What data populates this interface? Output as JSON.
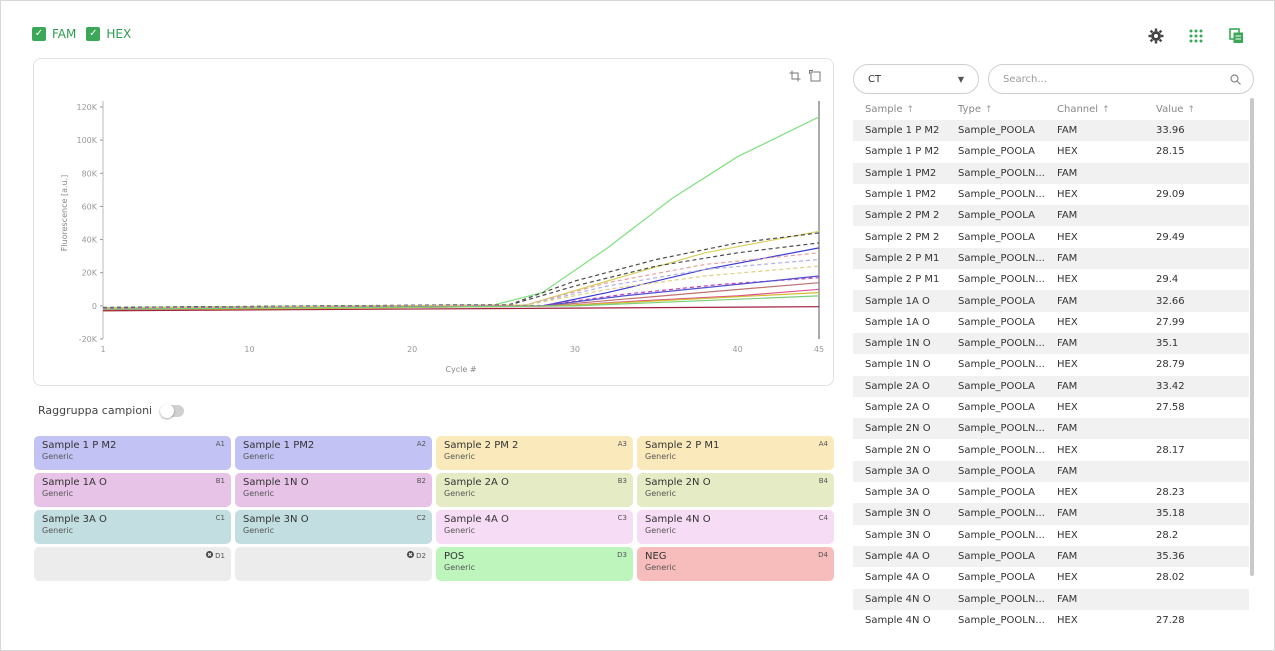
{
  "channels": [
    {
      "label": "FAM",
      "checked": true
    },
    {
      "label": "HEX",
      "checked": true
    }
  ],
  "toolbar_icons": [
    "settings-icon",
    "grid-dots-icon",
    "copy-icon"
  ],
  "chart_data": {
    "type": "line",
    "xlabel": "Cycle #",
    "ylabel": "Fluorescence [a.u.]",
    "xlim": [
      1,
      45
    ],
    "ylim": [
      -20000,
      120000
    ],
    "x_ticks": [
      "1",
      "10",
      "20",
      "30",
      "40",
      "45"
    ],
    "y_ticks": [
      "120K",
      "100K",
      "80K",
      "60K",
      "40K",
      "20K",
      "0",
      "-20K"
    ],
    "series": [
      {
        "color": "#7fe07f",
        "dash": false,
        "values": [
          [
            1,
            -1000
          ],
          [
            25,
            500
          ],
          [
            28,
            8000
          ],
          [
            32,
            35000
          ],
          [
            36,
            65000
          ],
          [
            40,
            90000
          ],
          [
            45,
            114000
          ]
        ]
      },
      {
        "color": "#d9d060",
        "dash": false,
        "values": [
          [
            1,
            -1500
          ],
          [
            27,
            500
          ],
          [
            32,
            15000
          ],
          [
            38,
            32000
          ],
          [
            45,
            45000
          ]
        ]
      },
      {
        "color": "#4a4a4a",
        "dash": true,
        "values": [
          [
            1,
            -1000
          ],
          [
            26,
            800
          ],
          [
            30,
            15000
          ],
          [
            35,
            28000
          ],
          [
            40,
            38000
          ],
          [
            45,
            44000
          ]
        ]
      },
      {
        "color": "#4a4a4a",
        "dash": true,
        "values": [
          [
            1,
            -1000
          ],
          [
            26,
            600
          ],
          [
            30,
            12000
          ],
          [
            35,
            24000
          ],
          [
            40,
            32000
          ],
          [
            45,
            38000
          ]
        ]
      },
      {
        "color": "#3b3bcf",
        "dash": false,
        "values": [
          [
            1,
            -2000
          ],
          [
            28,
            0
          ],
          [
            32,
            8000
          ],
          [
            38,
            22000
          ],
          [
            45,
            35000
          ]
        ]
      },
      {
        "color": "#e8a0a0",
        "dash": true,
        "values": [
          [
            1,
            -1500
          ],
          [
            27,
            500
          ],
          [
            32,
            14000
          ],
          [
            38,
            25000
          ],
          [
            45,
            32000
          ]
        ]
      },
      {
        "color": "#b0b0e8",
        "dash": true,
        "values": [
          [
            1,
            -1500
          ],
          [
            27,
            500
          ],
          [
            32,
            12000
          ],
          [
            38,
            22000
          ],
          [
            45,
            28000
          ]
        ]
      },
      {
        "color": "#e0d080",
        "dash": true,
        "values": [
          [
            1,
            -1500
          ],
          [
            27,
            400
          ],
          [
            32,
            10000
          ],
          [
            38,
            18000
          ],
          [
            45,
            24000
          ]
        ]
      },
      {
        "color": "#c040c0",
        "dash": true,
        "values": [
          [
            1,
            -1500
          ],
          [
            28,
            200
          ],
          [
            33,
            7000
          ],
          [
            39,
            13000
          ],
          [
            45,
            17000
          ]
        ]
      },
      {
        "color": "#5050d0",
        "dash": false,
        "values": [
          [
            1,
            -2500
          ],
          [
            28,
            0
          ],
          [
            33,
            6000
          ],
          [
            39,
            12000
          ],
          [
            45,
            18000
          ]
        ]
      },
      {
        "color": "#c07070",
        "dash": false,
        "values": [
          [
            1,
            -2500
          ],
          [
            28,
            -200
          ],
          [
            33,
            4000
          ],
          [
            39,
            9000
          ],
          [
            45,
            14000
          ]
        ]
      },
      {
        "color": "#e05090",
        "dash": false,
        "values": [
          [
            1,
            -2500
          ],
          [
            29,
            0
          ],
          [
            34,
            3000
          ],
          [
            40,
            6000
          ],
          [
            45,
            10000
          ]
        ]
      },
      {
        "color": "#d0c030",
        "dash": false,
        "values": [
          [
            1,
            -3000
          ],
          [
            29,
            0
          ],
          [
            35,
            3000
          ],
          [
            45,
            8000
          ]
        ]
      },
      {
        "color": "#7ad07a",
        "dash": false,
        "values": [
          [
            1,
            -2000
          ],
          [
            30,
            0
          ],
          [
            45,
            6000
          ]
        ]
      },
      {
        "color": "#a02040",
        "dash": false,
        "values": [
          [
            1,
            -3000
          ],
          [
            45,
            -500
          ]
        ]
      }
    ]
  },
  "group_toggle": {
    "label": "Raggruppa campioni",
    "on": false
  },
  "plate": [
    {
      "name": "Sample 1 P M2",
      "type": "Generic",
      "pos": "A1",
      "color": "#c2c2f5"
    },
    {
      "name": "Sample 1 PM2",
      "type": "Generic",
      "pos": "A2",
      "color": "#c2c2f5"
    },
    {
      "name": "Sample 2 PM 2",
      "type": "Generic",
      "pos": "A3",
      "color": "#faeabb"
    },
    {
      "name": "Sample 2 P M1",
      "type": "Generic",
      "pos": "A4",
      "color": "#faeabb"
    },
    {
      "name": "Sample 1A O",
      "type": "Generic",
      "pos": "B1",
      "color": "#e7c3e7"
    },
    {
      "name": "Sample 1N O",
      "type": "Generic",
      "pos": "B2",
      "color": "#e7c3e7"
    },
    {
      "name": "Sample 2A O",
      "type": "Generic",
      "pos": "B3",
      "color": "#e5ebc4"
    },
    {
      "name": "Sample 2N O",
      "type": "Generic",
      "pos": "B4",
      "color": "#e5ebc4"
    },
    {
      "name": "Sample 3A O",
      "type": "Generic",
      "pos": "C1",
      "color": "#c3dee0"
    },
    {
      "name": "Sample 3N O",
      "type": "Generic",
      "pos": "C2",
      "color": "#c3dee0"
    },
    {
      "name": "Sample 4A O",
      "type": "Generic",
      "pos": "C3",
      "color": "#f7dcf5"
    },
    {
      "name": "Sample 4N O",
      "type": "Generic",
      "pos": "C4",
      "color": "#f7dcf5"
    },
    {
      "name": "",
      "type": "",
      "pos": "D1",
      "color": "#ececec",
      "empty": true
    },
    {
      "name": "",
      "type": "",
      "pos": "D2",
      "color": "#ececec",
      "empty": true
    },
    {
      "name": "POS",
      "type": "Generic",
      "pos": "D3",
      "color": "#bdf5bd"
    },
    {
      "name": "NEG",
      "type": "Generic",
      "pos": "D4",
      "color": "#f7bcbc"
    }
  ],
  "filter": {
    "selected": "CT"
  },
  "search": {
    "placeholder": "Search..."
  },
  "table": {
    "headers": [
      "Sample",
      "Type",
      "Channel",
      "Value"
    ],
    "rows": [
      [
        "Sample 1 P M2",
        "Sample_POOLA",
        "FAM",
        "33.96"
      ],
      [
        "Sample 1 P M2",
        "Sample_POOLA",
        "HEX",
        "28.15"
      ],
      [
        "Sample 1 PM2",
        "Sample_POOLN...",
        "FAM",
        ""
      ],
      [
        "Sample 1 PM2",
        "Sample_POOLN...",
        "HEX",
        "29.09"
      ],
      [
        "Sample 2 PM 2",
        "Sample_POOLA",
        "FAM",
        ""
      ],
      [
        "Sample 2 PM 2",
        "Sample_POOLA",
        "HEX",
        "29.49"
      ],
      [
        "Sample 2 P M1",
        "Sample_POOLN...",
        "FAM",
        ""
      ],
      [
        "Sample 2 P M1",
        "Sample_POOLN...",
        "HEX",
        "29.4"
      ],
      [
        "Sample 1A O",
        "Sample_POOLA",
        "FAM",
        "32.66"
      ],
      [
        "Sample 1A O",
        "Sample_POOLA",
        "HEX",
        "27.99"
      ],
      [
        "Sample 1N O",
        "Sample_POOLN...",
        "FAM",
        "35.1"
      ],
      [
        "Sample 1N O",
        "Sample_POOLN...",
        "HEX",
        "28.79"
      ],
      [
        "Sample 2A O",
        "Sample_POOLA",
        "FAM",
        "33.42"
      ],
      [
        "Sample 2A O",
        "Sample_POOLA",
        "HEX",
        "27.58"
      ],
      [
        "Sample 2N O",
        "Sample_POOLN...",
        "FAM",
        ""
      ],
      [
        "Sample 2N O",
        "Sample_POOLN...",
        "HEX",
        "28.17"
      ],
      [
        "Sample 3A O",
        "Sample_POOLA",
        "FAM",
        ""
      ],
      [
        "Sample 3A O",
        "Sample_POOLA",
        "HEX",
        "28.23"
      ],
      [
        "Sample 3N O",
        "Sample_POOLN...",
        "FAM",
        "35.18"
      ],
      [
        "Sample 3N O",
        "Sample_POOLN...",
        "HEX",
        "28.2"
      ],
      [
        "Sample 4A O",
        "Sample_POOLA",
        "FAM",
        "35.36"
      ],
      [
        "Sample 4A O",
        "Sample_POOLA",
        "HEX",
        "28.02"
      ],
      [
        "Sample 4N O",
        "Sample_POOLN...",
        "FAM",
        ""
      ],
      [
        "Sample 4N O",
        "Sample_POOLN...",
        "HEX",
        "27.28"
      ]
    ]
  },
  "colors": {
    "accent": "#3aa856"
  }
}
